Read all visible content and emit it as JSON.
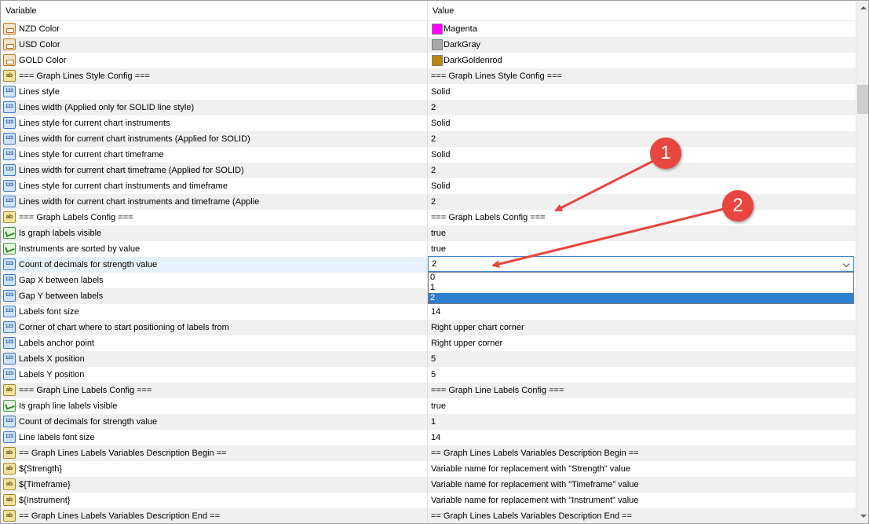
{
  "header": {
    "variable": "Variable",
    "value": "Value"
  },
  "rows": [
    {
      "type": "clr",
      "label": "NZD Color",
      "value": "Magenta",
      "swatch": "#ff00ff"
    },
    {
      "type": "clr",
      "label": "USD Color",
      "value": "DarkGray",
      "swatch": "#a9a9a9"
    },
    {
      "type": "clr",
      "label": "GOLD Color",
      "value": "DarkGoldenrod",
      "swatch": "#b8860b"
    },
    {
      "type": "str",
      "label": "=== Graph Lines Style Config ===",
      "value": "=== Graph Lines Style Config ==="
    },
    {
      "type": "num",
      "label": "Lines style",
      "value": "Solid"
    },
    {
      "type": "num",
      "label": "Lines width (Applied only for SOLID line style)",
      "value": "2"
    },
    {
      "type": "num",
      "label": "Lines style for current chart instruments",
      "value": "Solid"
    },
    {
      "type": "num",
      "label": "Lines width for current chart instruments (Applied for SOLID)",
      "value": "2"
    },
    {
      "type": "num",
      "label": "Lines style for current chart timeframe",
      "value": "Solid"
    },
    {
      "type": "num",
      "label": "Lines width for current chart timeframe (Applied for SOLID)",
      "value": "2"
    },
    {
      "type": "num",
      "label": "Lines style for current chart instruments and timeframe",
      "value": "Solid"
    },
    {
      "type": "num",
      "label": "Lines width for current chart instruments and timeframe (Applie",
      "value": "2"
    },
    {
      "type": "str",
      "label": "=== Graph Labels Config ===",
      "value": "=== Graph Labels Config ==="
    },
    {
      "type": "bool",
      "label": "Is graph labels visible",
      "value": "true"
    },
    {
      "type": "bool",
      "label": "Instruments are sorted by value",
      "value": "true"
    },
    {
      "type": "num",
      "label": "Count of decimals for strength value",
      "value": "2",
      "selected": true
    },
    {
      "type": "num",
      "label": "Gap X between labels",
      "value": ""
    },
    {
      "type": "num",
      "label": "Gap Y between labels",
      "value": ""
    },
    {
      "type": "num",
      "label": "Labels font size",
      "value": "14"
    },
    {
      "type": "num",
      "label": "Corner of chart where to start positioning of labels from",
      "value": "Right upper chart corner"
    },
    {
      "type": "num",
      "label": "Labels anchor point",
      "value": "Right upper corner"
    },
    {
      "type": "num",
      "label": "Labels X position",
      "value": "5"
    },
    {
      "type": "num",
      "label": "Labels Y position",
      "value": "5"
    },
    {
      "type": "str",
      "label": "=== Graph Line Labels Config ===",
      "value": "=== Graph Line Labels Config ==="
    },
    {
      "type": "bool",
      "label": "Is graph line labels visible",
      "value": "true"
    },
    {
      "type": "num",
      "label": "Count of decimals for strength value",
      "value": "1"
    },
    {
      "type": "num",
      "label": "Line labels font size",
      "value": "14"
    },
    {
      "type": "str",
      "label": "== Graph Lines Labels Variables Description Begin ==",
      "value": "== Graph Lines Labels Variables Description Begin =="
    },
    {
      "type": "str",
      "label": "${Strength}",
      "value": "Variable name for replacement with \"Strength\" value"
    },
    {
      "type": "str",
      "label": "${Timeframe}",
      "value": "Variable name for replacement with \"Timeframe\" value"
    },
    {
      "type": "str",
      "label": "${Instrument}",
      "value": "Variable name for replacement with \"Instrument\" value"
    },
    {
      "type": "str",
      "label": "== Graph Lines Labels Variables Description End ==",
      "value": "== Graph Lines Labels Variables Description End =="
    }
  ],
  "combo": {
    "value": "2",
    "options": [
      "0",
      "1",
      "2"
    ],
    "selected_index": 2
  },
  "icons": {
    "num": "123",
    "str": "ab"
  },
  "callouts": {
    "first": "1",
    "second": "2"
  },
  "colors": {
    "callout": "#e8463e",
    "selection": "#2f80d1"
  }
}
